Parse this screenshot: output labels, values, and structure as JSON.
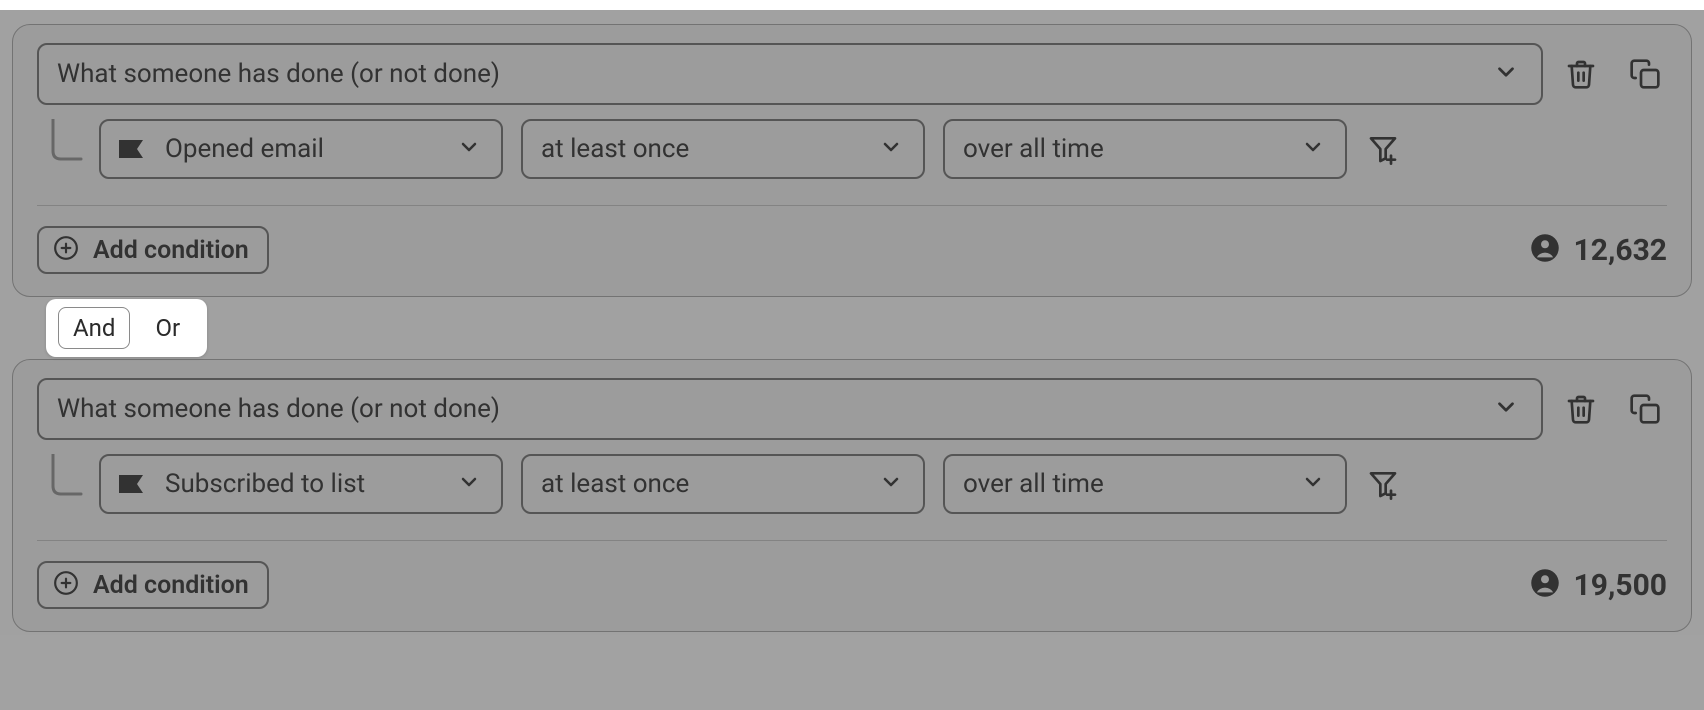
{
  "conditions": [
    {
      "main_label": "What someone has done (or not done)",
      "metric_label": "Opened email",
      "frequency_label": "at least once",
      "timeframe_label": "over all time",
      "add_condition_label": "Add condition",
      "count": "12,632"
    },
    {
      "main_label": "What someone has done (or not done)",
      "metric_label": "Subscribed to list",
      "frequency_label": "at least once",
      "timeframe_label": "over all time",
      "add_condition_label": "Add condition",
      "count": "19,500"
    }
  ],
  "logic": {
    "and_label": "And",
    "or_label": "Or",
    "active": "and"
  }
}
